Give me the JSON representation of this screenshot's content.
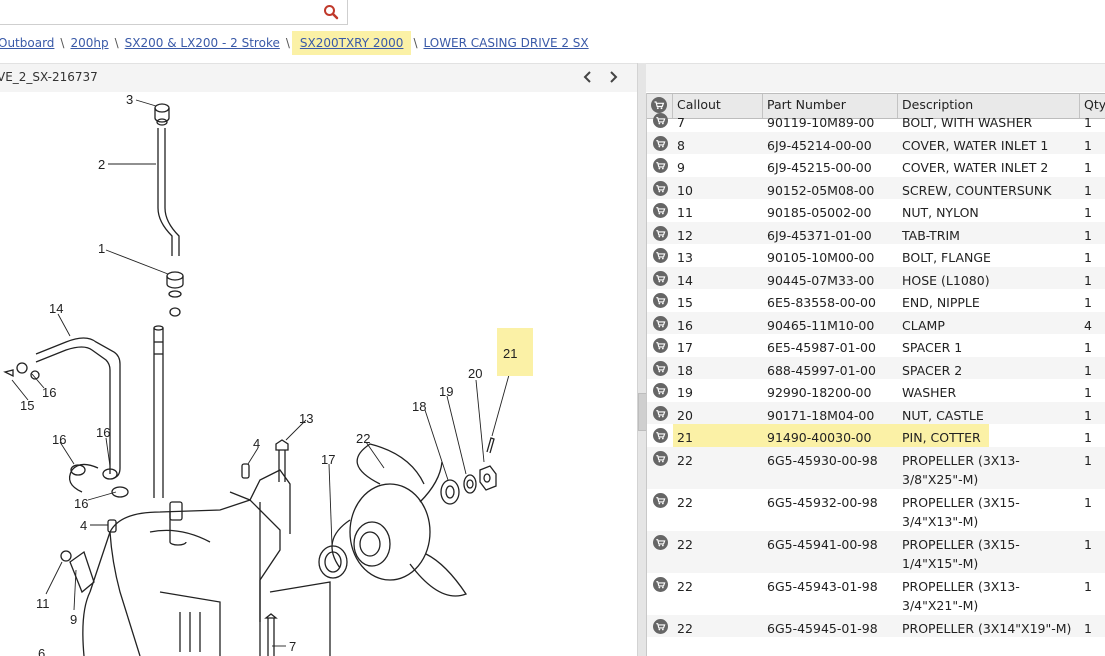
{
  "search": {
    "placeholder": ""
  },
  "breadcrumb": {
    "items": [
      "Outboard",
      "200hp",
      "SX200 & LX200 - 2 Stroke",
      "SX200TXRY 2000",
      "LOWER CASING DRIVE 2 SX"
    ],
    "separator": "\\",
    "highlight_color": "#fbf1a6"
  },
  "diagram": {
    "title": "VE_2_SX-216737",
    "callouts": [
      "3",
      "2",
      "1",
      "14",
      "16",
      "15",
      "16",
      "16",
      "16",
      "4",
      "11",
      "9",
      "13",
      "4",
      "17",
      "7",
      "6",
      "18",
      "19",
      "22",
      "20",
      "21"
    ],
    "highlighted_callout": "21"
  },
  "parts_table": {
    "columns": [
      "Callout",
      "Part Number",
      "Description",
      "Qty"
    ],
    "rows": [
      {
        "callout": "7",
        "part_number": "90119-10M89-00",
        "description": "BOLT, WITH WASHER",
        "qty": "1"
      },
      {
        "callout": "8",
        "part_number": "6J9-45214-00-00",
        "description": "COVER, WATER INLET 1",
        "qty": "1"
      },
      {
        "callout": "9",
        "part_number": "6J9-45215-00-00",
        "description": "COVER, WATER INLET 2",
        "qty": "1"
      },
      {
        "callout": "10",
        "part_number": "90152-05M08-00",
        "description": "SCREW, COUNTERSUNK",
        "qty": "1"
      },
      {
        "callout": "11",
        "part_number": "90185-05002-00",
        "description": "NUT, NYLON",
        "qty": "1"
      },
      {
        "callout": "12",
        "part_number": "6J9-45371-01-00",
        "description": "TAB-TRIM",
        "qty": "1"
      },
      {
        "callout": "13",
        "part_number": "90105-10M00-00",
        "description": "BOLT, FLANGE",
        "qty": "1"
      },
      {
        "callout": "14",
        "part_number": "90445-07M33-00",
        "description": "HOSE (L1080)",
        "qty": "1"
      },
      {
        "callout": "15",
        "part_number": "6E5-83558-00-00",
        "description": "END, NIPPLE",
        "qty": "1"
      },
      {
        "callout": "16",
        "part_number": "90465-11M10-00",
        "description": "CLAMP",
        "qty": "4"
      },
      {
        "callout": "17",
        "part_number": "6E5-45987-01-00",
        "description": "SPACER 1",
        "qty": "1"
      },
      {
        "callout": "18",
        "part_number": "688-45997-01-00",
        "description": "SPACER 2",
        "qty": "1"
      },
      {
        "callout": "19",
        "part_number": "92990-18200-00",
        "description": "WASHER",
        "qty": "1"
      },
      {
        "callout": "20",
        "part_number": "90171-18M04-00",
        "description": "NUT, CASTLE",
        "qty": "1"
      },
      {
        "callout": "21",
        "part_number": "91490-40030-00",
        "description": "PIN, COTTER",
        "qty": "1",
        "highlighted": true
      },
      {
        "callout": "22",
        "part_number": "6G5-45930-00-98",
        "description": "PROPELLER (3X13-3/8\"X25\"-M)",
        "qty": "1"
      },
      {
        "callout": "22",
        "part_number": "6G5-45932-00-98",
        "description": "PROPELLER (3X15-3/4\"X13\"-M)",
        "qty": "1"
      },
      {
        "callout": "22",
        "part_number": "6G5-45941-00-98",
        "description": "PROPELLER (3X15-1/4\"X15\"-M)",
        "qty": "1"
      },
      {
        "callout": "22",
        "part_number": "6G5-45943-01-98",
        "description": "PROPELLER (3X13-3/4\"X21\"-M)",
        "qty": "1"
      },
      {
        "callout": "22",
        "part_number": "6G5-45945-01-98",
        "description": "PROPELLER (3X14\"X19\"-M)",
        "qty": "1"
      }
    ]
  },
  "colors": {
    "link": "#3a5aa8",
    "highlight": "#fbf1a6",
    "search_icon": "#c0392b",
    "cart_icon": "#666666"
  }
}
